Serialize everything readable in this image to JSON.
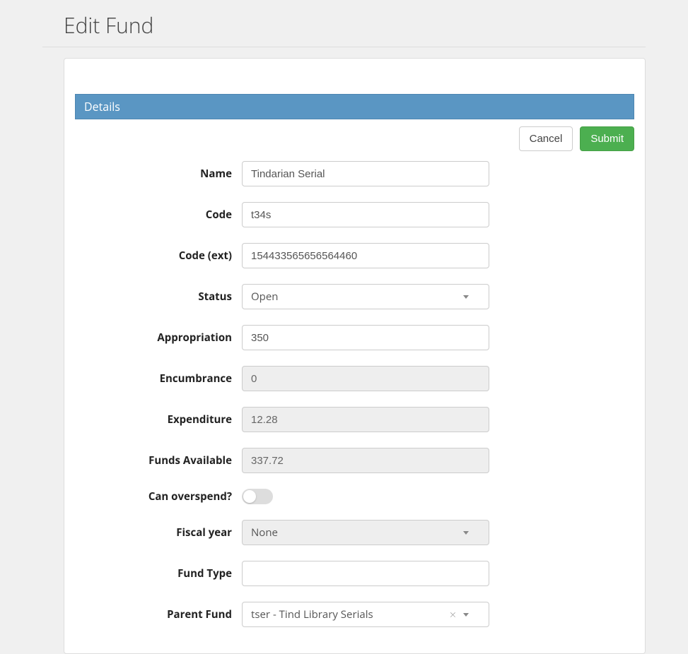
{
  "header": {
    "title": "Edit Fund"
  },
  "panel": {
    "title": "Details"
  },
  "buttons": {
    "cancel": "Cancel",
    "submit": "Submit"
  },
  "labels": {
    "name": "Name",
    "code": "Code",
    "code_ext": "Code (ext)",
    "status": "Status",
    "appropriation": "Appropriation",
    "encumbrance": "Encumbrance",
    "expenditure": "Expenditure",
    "funds_available": "Funds Available",
    "can_overspend": "Can overspend?",
    "fiscal_year": "Fiscal year",
    "fund_type": "Fund Type",
    "parent_fund": "Parent Fund"
  },
  "values": {
    "name": "Tindarian Serial",
    "code": "t34s",
    "code_ext": "154433565656564460",
    "status": "Open",
    "appropriation": "350",
    "encumbrance": "0",
    "expenditure": "12.28",
    "funds_available": "337.72",
    "can_overspend": false,
    "fiscal_year": "None",
    "fund_type": "",
    "parent_fund": "tser - Tind Library Serials"
  }
}
